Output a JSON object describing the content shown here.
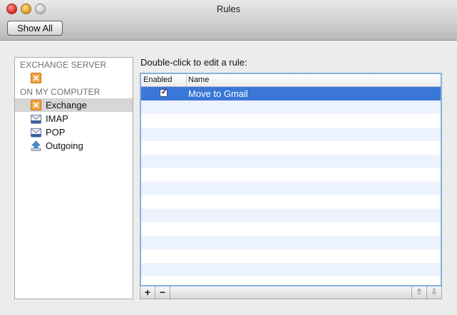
{
  "window": {
    "title": "Rules"
  },
  "toolbar": {
    "show_all_label": "Show All"
  },
  "sidebar": {
    "exchange_server_header": "EXCHANGE SERVER",
    "on_my_computer_header": "ON MY COMPUTER",
    "items": [
      {
        "label": "Exchange",
        "icon": "exchange-icon",
        "selected": true
      },
      {
        "label": "IMAP",
        "icon": "imap-icon",
        "selected": false
      },
      {
        "label": "POP",
        "icon": "pop-icon",
        "selected": false
      },
      {
        "label": "Outgoing",
        "icon": "outgoing-icon",
        "selected": false
      }
    ]
  },
  "main": {
    "caption": "Double-click to edit a rule:",
    "columns": [
      "Enabled",
      "Name"
    ],
    "rules": [
      {
        "enabled": true,
        "name": "Move to Gmail"
      }
    ]
  },
  "bottom_bar": {
    "add_label": "+",
    "remove_label": "−",
    "move_up_glyph": "⇧",
    "move_down_glyph": "⇩"
  },
  "colors": {
    "selection": "#3a77d6",
    "alt_row": "#edf3fe",
    "table_focus_border": "#86b0e0",
    "exchange_icon": "#f0a340"
  }
}
